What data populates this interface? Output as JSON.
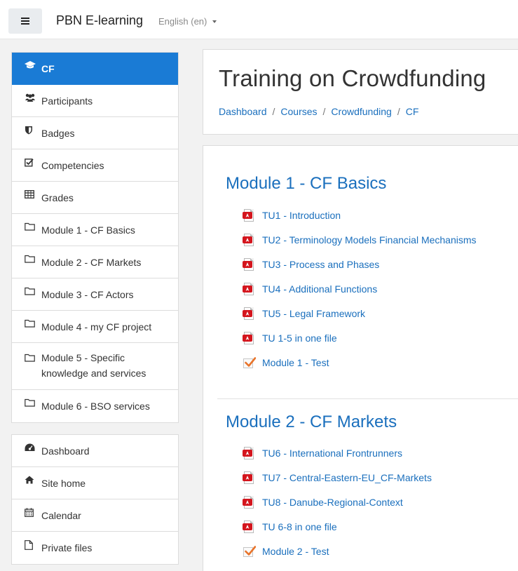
{
  "navbar": {
    "brand": "PBN E-learning",
    "language": "English (en)"
  },
  "sidebar": {
    "course_items": [
      {
        "label": "CF",
        "icon": "graduation-cap-icon",
        "active": true
      },
      {
        "label": "Participants",
        "icon": "users-icon"
      },
      {
        "label": "Badges",
        "icon": "shield-icon"
      },
      {
        "label": "Competencies",
        "icon": "checked-box-icon"
      },
      {
        "label": "Grades",
        "icon": "table-icon"
      },
      {
        "label": "Module 1 - CF Basics",
        "icon": "folder-icon"
      },
      {
        "label": "Module 2 - CF Markets",
        "icon": "folder-icon"
      },
      {
        "label": "Module 3 - CF Actors",
        "icon": "folder-icon"
      },
      {
        "label": "Module 4 - my CF project",
        "icon": "folder-icon"
      },
      {
        "label": "Module 5 - Specific knowledge and services",
        "icon": "folder-icon"
      },
      {
        "label": "Module 6 - BSO services",
        "icon": "folder-icon"
      }
    ],
    "site_items": [
      {
        "label": "Dashboard",
        "icon": "dashboard-icon"
      },
      {
        "label": "Site home",
        "icon": "home-icon"
      },
      {
        "label": "Calendar",
        "icon": "calendar-icon"
      },
      {
        "label": "Private files",
        "icon": "file-icon"
      }
    ]
  },
  "header": {
    "title": "Training on Crowdfunding",
    "breadcrumb": [
      "Dashboard",
      "Courses",
      "Crowdfunding",
      "CF"
    ],
    "separator": "/"
  },
  "sections": [
    {
      "title": "Module 1 - CF Basics",
      "activities": [
        {
          "label": "TU1 - Introduction",
          "type": "pdf"
        },
        {
          "label": "TU2 - Terminology Models Financial Mechanisms",
          "type": "pdf"
        },
        {
          "label": "TU3 - Process and Phases",
          "type": "pdf"
        },
        {
          "label": "TU4 - Additional Functions",
          "type": "pdf"
        },
        {
          "label": "TU5 - Legal Framework",
          "type": "pdf"
        },
        {
          "label": "TU 1-5 in one file",
          "type": "pdf"
        },
        {
          "label": "Module 1 - Test",
          "type": "quiz"
        }
      ]
    },
    {
      "title": "Module 2 - CF Markets",
      "activities": [
        {
          "label": "TU6 - International Frontrunners",
          "type": "pdf"
        },
        {
          "label": "TU7 - Central-Eastern-EU_CF-Markets",
          "type": "pdf"
        },
        {
          "label": "TU8 - Danube-Regional-Context",
          "type": "pdf"
        },
        {
          "label": "TU 6-8 in one file",
          "type": "pdf"
        },
        {
          "label": "Module 2 - Test",
          "type": "quiz"
        }
      ]
    }
  ],
  "colors": {
    "accent": "#1a7bd5",
    "link": "#1a6fbd",
    "pdf_red": "#d4151d",
    "check_orange": "#e8732a"
  }
}
